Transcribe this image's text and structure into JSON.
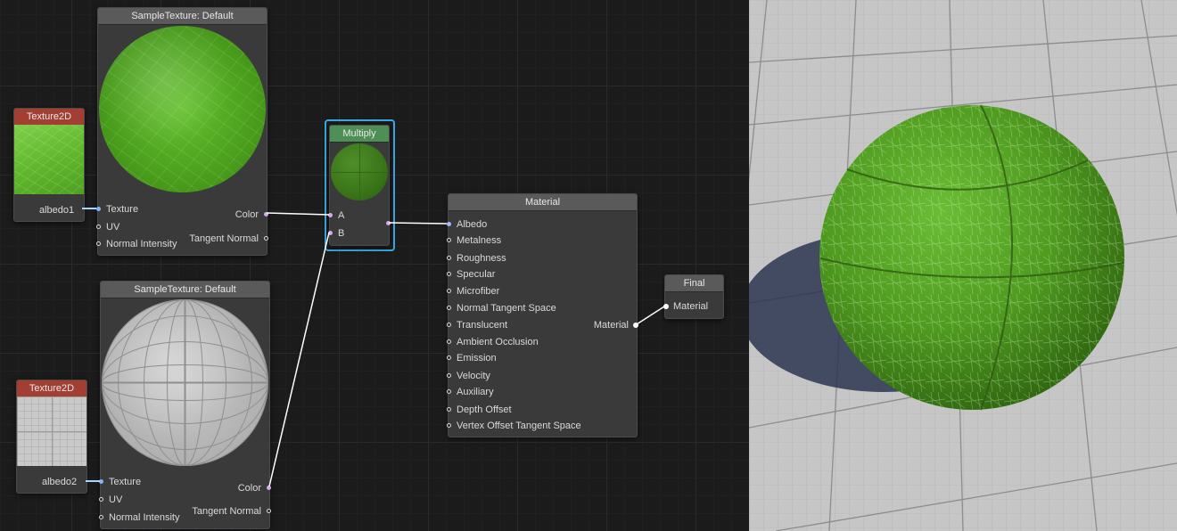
{
  "nodes": {
    "texture2d_1": {
      "title": "Texture2D",
      "name": "albedo1"
    },
    "texture2d_2": {
      "title": "Texture2D",
      "name": "albedo2"
    },
    "sample1": {
      "title": "SampleTexture: Default",
      "inputs": [
        "Texture",
        "UV",
        "Normal Intensity"
      ],
      "outputs": [
        "Color",
        "Tangent Normal"
      ]
    },
    "sample2": {
      "title": "SampleTexture: Default",
      "inputs": [
        "Texture",
        "UV",
        "Normal Intensity"
      ],
      "outputs": [
        "Color",
        "Tangent Normal"
      ]
    },
    "multiply": {
      "title": "Multiply",
      "inputs": [
        "A",
        "B"
      ]
    },
    "material": {
      "title": "Material",
      "inputs": [
        "Albedo",
        "Metalness",
        "Roughness",
        "Specular",
        "Microfiber",
        "Normal Tangent Space",
        "Translucent",
        "Ambient Occlusion",
        "Emission",
        "Velocity",
        "Auxiliary",
        "Depth Offset",
        "Vertex Offset Tangent Space"
      ],
      "outputs": [
        "Material"
      ]
    },
    "final": {
      "title": "Final",
      "inputs": [
        "Material"
      ]
    }
  },
  "colors": {
    "graph_bg": "#1b1b1c",
    "node_bg": "#3a3a3b",
    "node_header": "#5a5a5b",
    "texture_header": "#a33e33",
    "multiply_header": "#4e8f55",
    "selection": "#3ea6de",
    "wire": "#ffffff",
    "port_texture": "#7fb6ff",
    "port_vector": "#d7a7f0"
  }
}
